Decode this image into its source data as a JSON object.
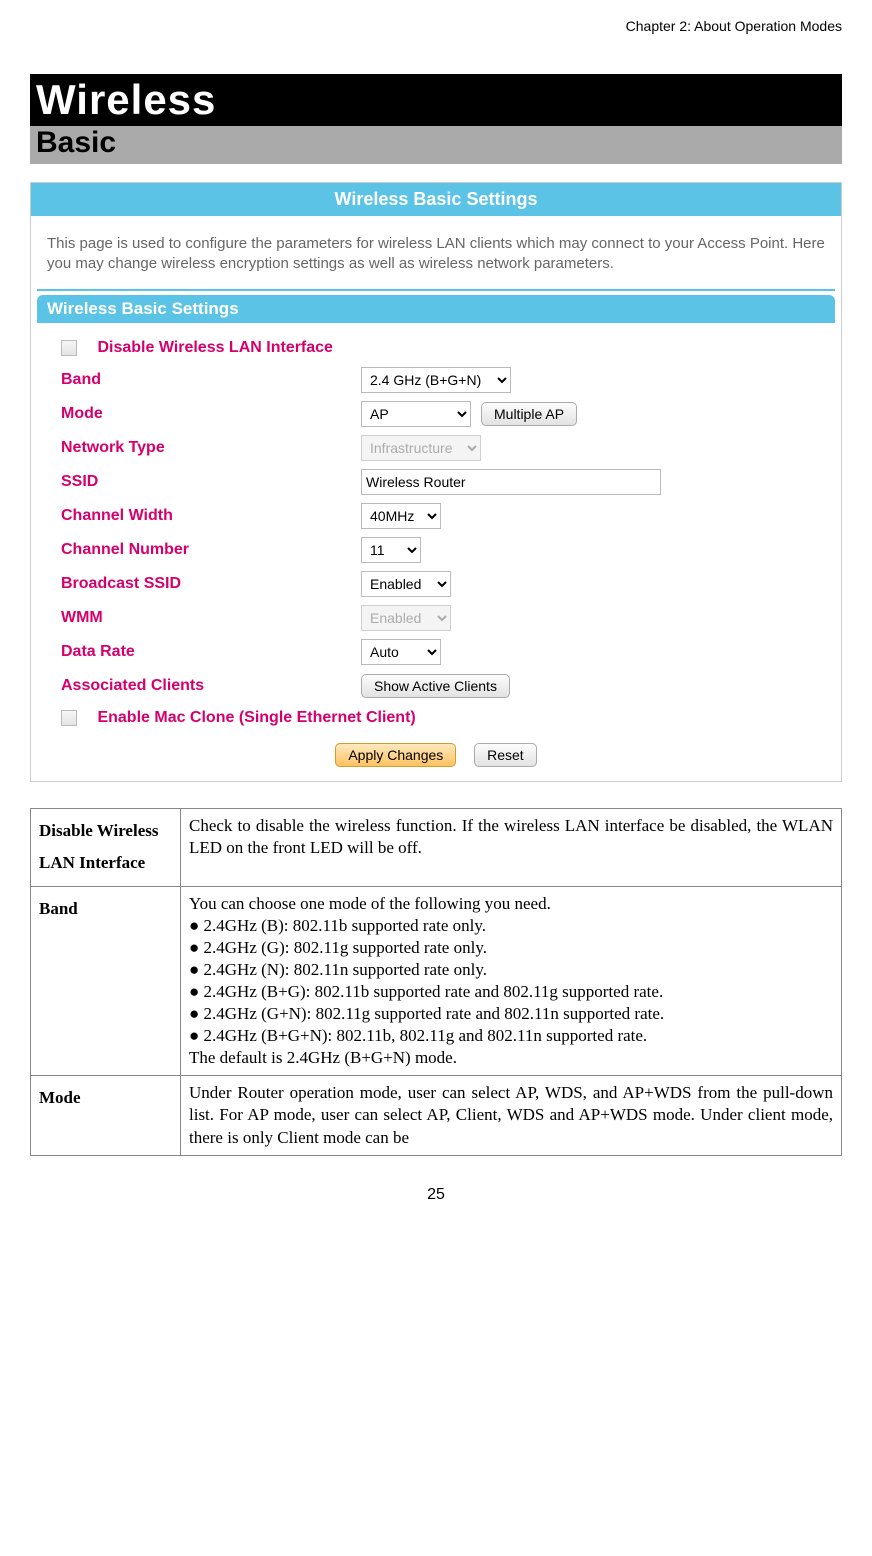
{
  "header": {
    "chapter": "Chapter 2: About Operation Modes"
  },
  "title_black": "Wireless",
  "title_gray": "Basic",
  "panel": {
    "title": "Wireless Basic Settings",
    "description": "This page is used to configure the parameters for wireless LAN clients which may connect to your Access Point. Here you may change wireless encryption settings as well as wireless network parameters.",
    "sub": "Wireless Basic Settings",
    "disable_label": "Disable Wireless LAN Interface",
    "labels": {
      "band": "Band",
      "mode": "Mode",
      "nettype": "Network Type",
      "ssid": "SSID",
      "chwidth": "Channel Width",
      "chnum": "Channel Number",
      "bssid": "Broadcast SSID",
      "wmm": "WMM",
      "drate": "Data Rate",
      "asclients": "Associated Clients"
    },
    "values": {
      "band": "2.4 GHz (B+G+N)",
      "mode": "AP",
      "multiple_ap_btn": "Multiple AP",
      "nettype": "Infrastructure",
      "ssid": "Wireless Router",
      "chwidth": "40MHz",
      "chnum": "11",
      "bssid": "Enabled",
      "wmm": "Enabled",
      "drate": "Auto",
      "show_clients_btn": "Show Active Clients"
    },
    "enable_mac_label": "Enable Mac Clone (Single Ethernet Client)",
    "apply_btn": "Apply Changes",
    "reset_btn": "Reset"
  },
  "table": {
    "r1": {
      "h": "Disable Wireless LAN Interface",
      "c": "Check to disable the wireless function.  If the wireless LAN interface be disabled, the WLAN LED on the front LED will be off."
    },
    "r2": {
      "h": "Band",
      "intro": "You can choose one mode of the following you need.",
      "items": [
        "2.4GHz (B): 802.11b supported rate only.",
        "2.4GHz (G): 802.11g supported rate only.",
        "2.4GHz (N): 802.11n supported rate only.",
        "2.4GHz (B+G): 802.11b supported rate and 802.11g supported rate.",
        "2.4GHz (G+N): 802.11g supported rate and 802.11n supported rate.",
        "2.4GHz (B+G+N): 802.11b, 802.11g and 802.11n supported rate."
      ],
      "outro": "The default is 2.4GHz (B+G+N) mode."
    },
    "r3": {
      "h": "Mode",
      "c": "Under Router operation mode, user can select AP, WDS, and AP+WDS from the pull-down list. For AP mode, user can select AP, Client, WDS and AP+WDS mode. Under client mode, there is only Client mode can be"
    }
  },
  "page_number": "25"
}
